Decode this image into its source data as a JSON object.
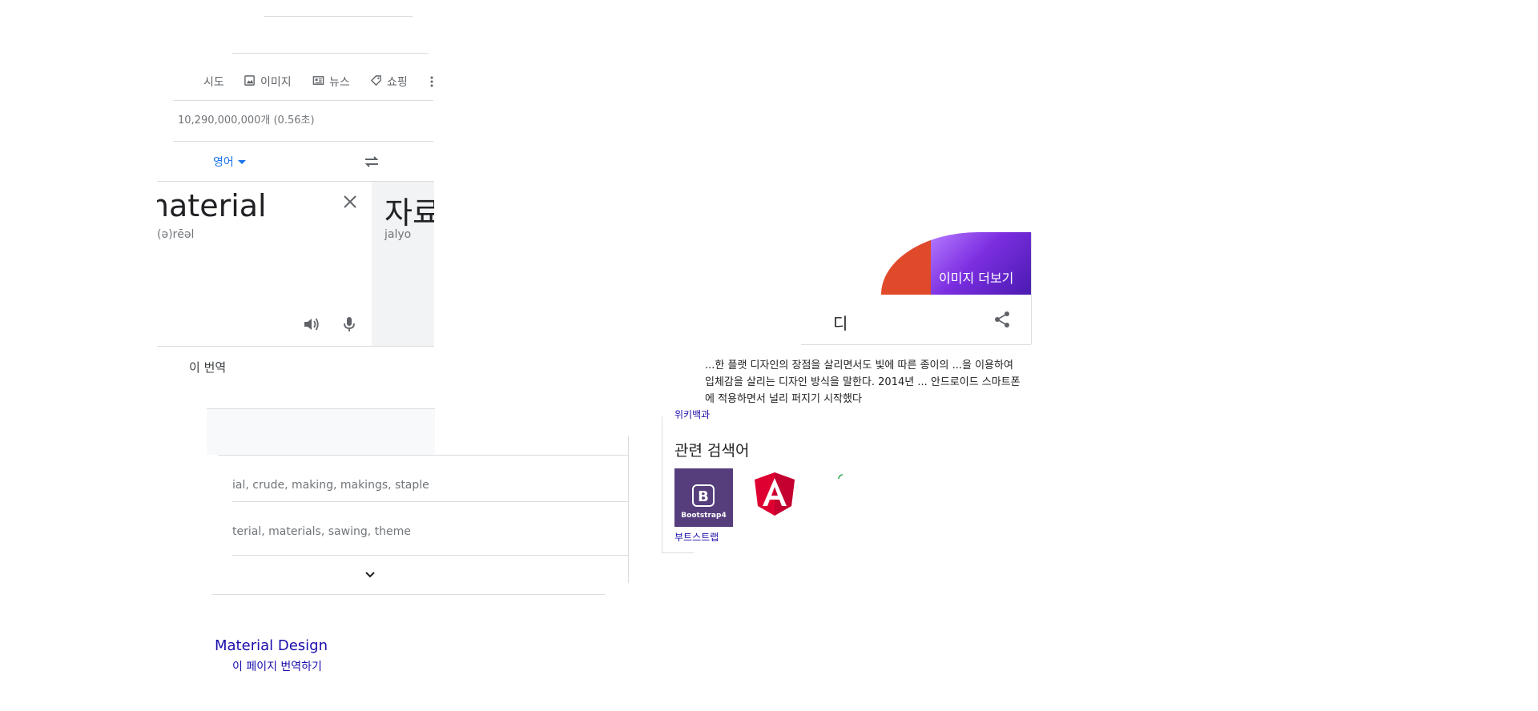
{
  "tabs": [
    {
      "label": "시도",
      "icon": "none"
    },
    {
      "label": "이미지",
      "icon": "image-icon"
    },
    {
      "label": "뉴스",
      "icon": "news-icon"
    },
    {
      "label": "쇼핑",
      "icon": "tag-icon"
    }
  ],
  "stats": "10,290,000,000개 (0.56초)",
  "translate": {
    "source_lang": "영어",
    "source_text": "material",
    "source_phonetic": "(ə)rēəl",
    "target_text": "자료",
    "target_romanization": "jalyo",
    "open_link": "이 번역"
  },
  "definitions": [
    "ial, crude, making, makings, staple",
    "terial, materials, sawing, theme"
  ],
  "result": {
    "title": "Material Design",
    "translate_link": "이 페이지 번역하기"
  },
  "knowledge_panel": {
    "more_images": "이미지 더보기",
    "title": "디",
    "description": "...한 플랫 디자인의 장점을 살리면서도 빛에 따른 종이의 ...을 이용하여 입체감을 살리는 디자인 방식을 말한다. 2014년 ... 안드로이드 스마트폰에 적용하면서 널리 퍼지기 시작했다",
    "source": "위키백과",
    "related_heading": "관련 검색어",
    "related": [
      {
        "label": "부트스트랩",
        "image_text": "Bootstrap4",
        "image_letter": "B"
      }
    ]
  },
  "colors": {
    "link": "#1a0dab",
    "accent_blue": "#1a73e8",
    "bootstrap": "#563d7c",
    "angular": "#dd0031"
  }
}
